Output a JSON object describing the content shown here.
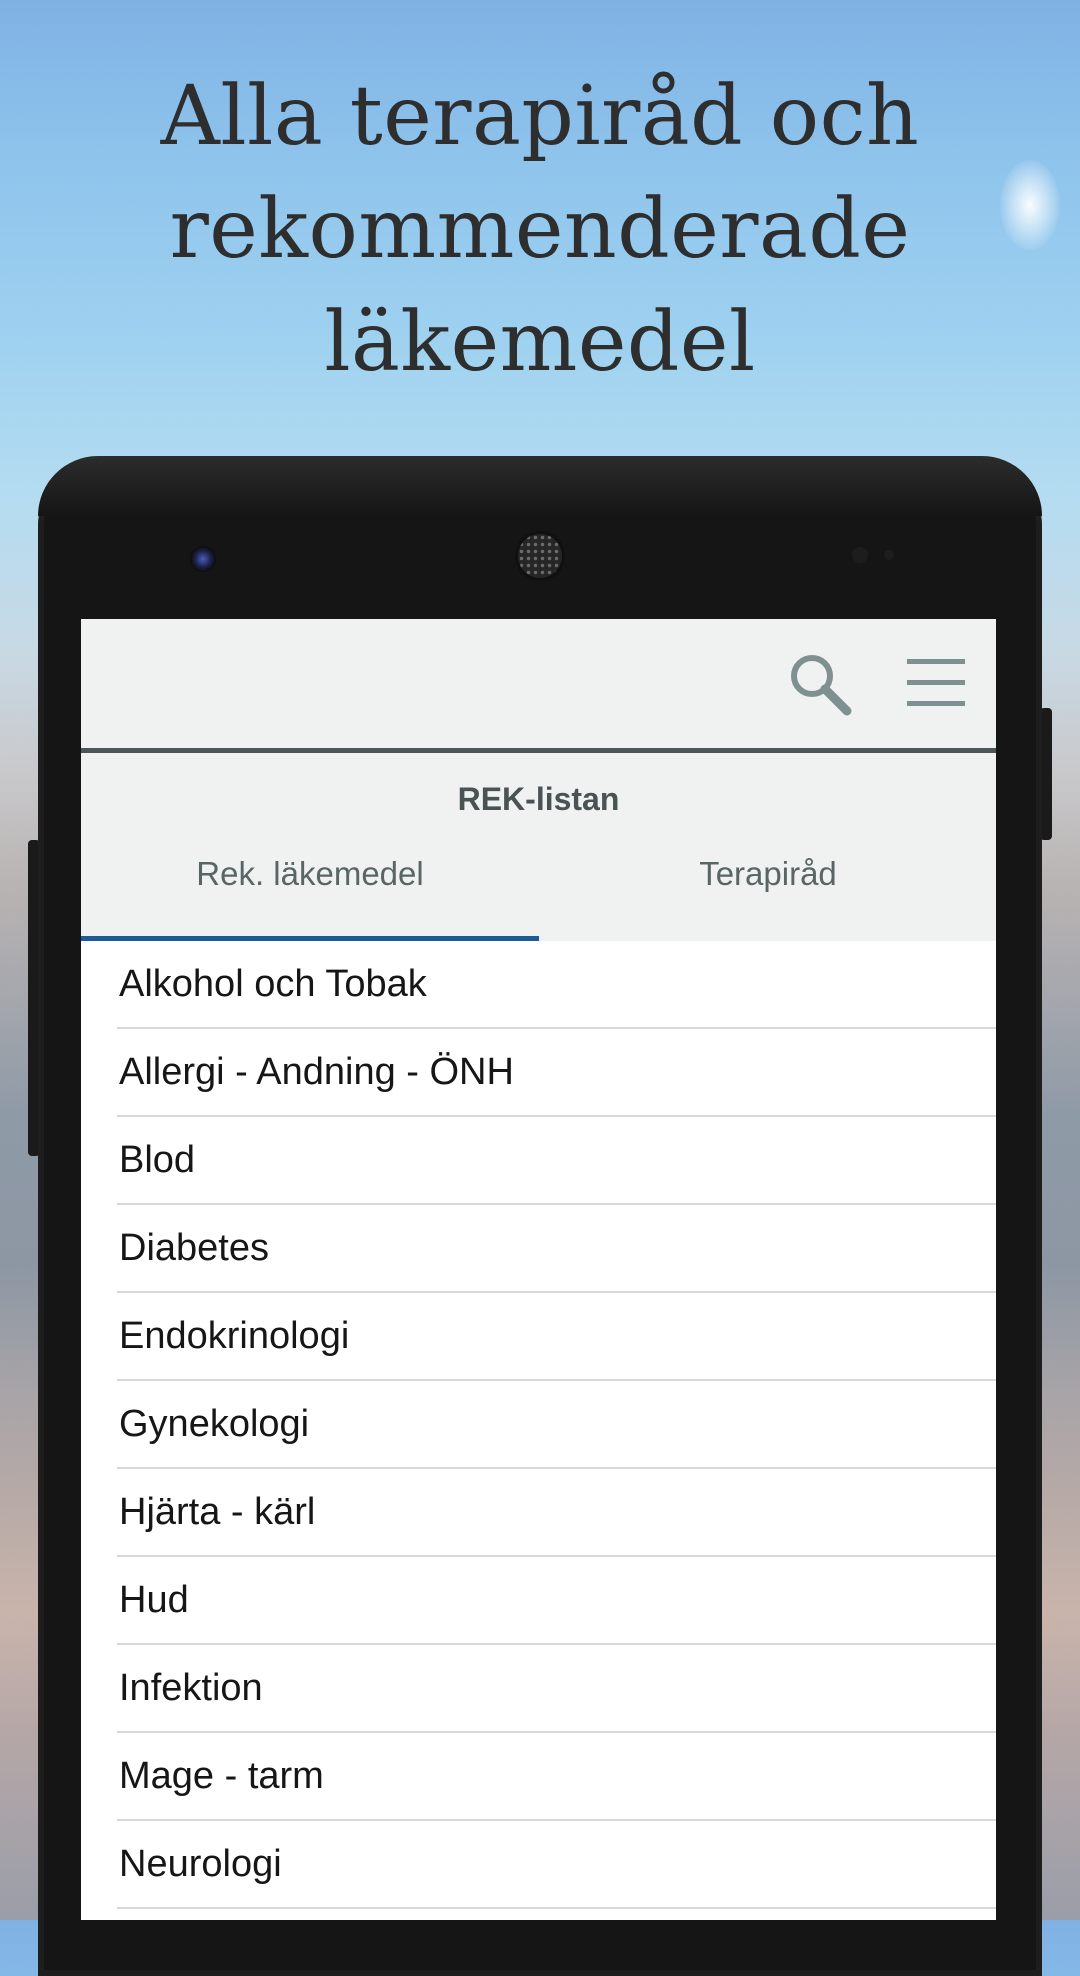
{
  "headline": {
    "line1": "Alla terapiråd och",
    "line2": "rekommenderade",
    "line3": "läkemedel"
  },
  "toolbar": {
    "search_icon": "search-icon",
    "menu_icon": "hamburger-menu-icon"
  },
  "app": {
    "title": "REK-listan"
  },
  "tabs": [
    {
      "label": "Rek. läkemedel",
      "active": true
    },
    {
      "label": "Terapiråd",
      "active": false
    }
  ],
  "categories": [
    {
      "label": "Alkohol och Tobak"
    },
    {
      "label": "Allergi - Andning - ÖNH"
    },
    {
      "label": "Blod"
    },
    {
      "label": "Diabetes"
    },
    {
      "label": "Endokrinologi"
    },
    {
      "label": "Gynekologi"
    },
    {
      "label": "Hjärta - kärl"
    },
    {
      "label": "Hud"
    },
    {
      "label": "Infektion"
    },
    {
      "label": "Mage - tarm"
    },
    {
      "label": "Neurologi"
    }
  ],
  "colors": {
    "accent": "#1b5b98",
    "toolbar_border": "#4d5757",
    "header_bg": "#eff2f1",
    "icon": "#7e9090"
  }
}
